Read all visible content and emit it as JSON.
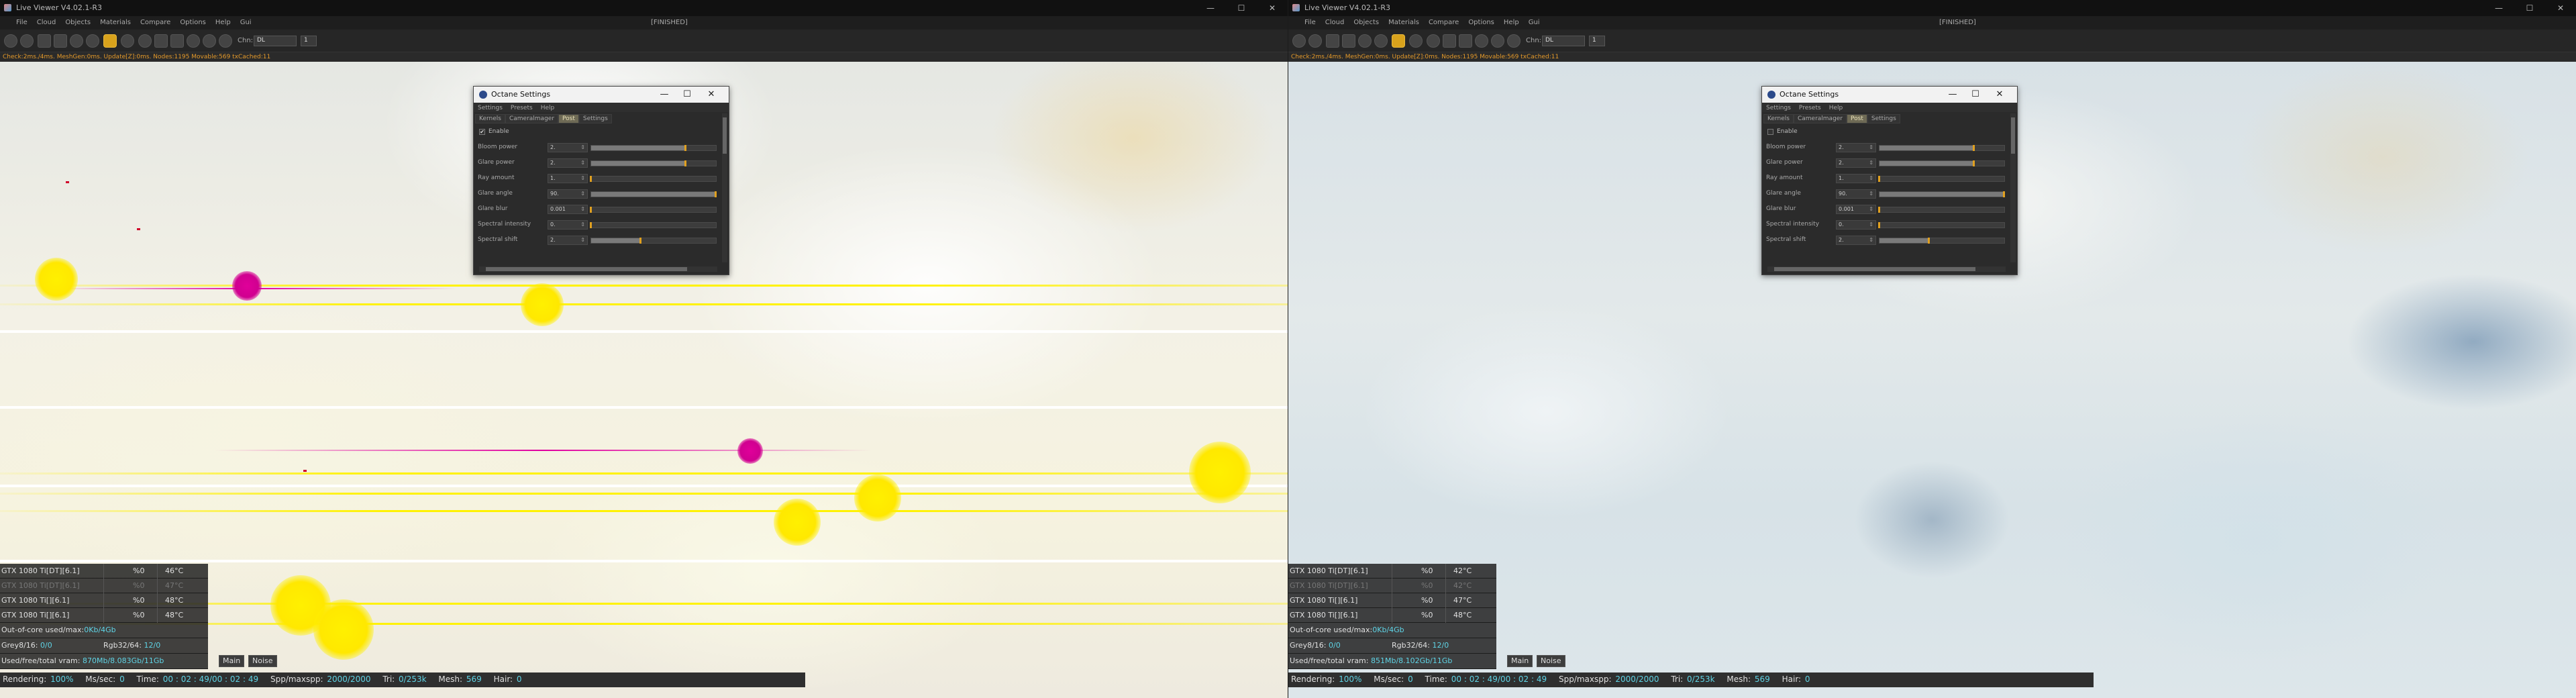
{
  "windows": [
    {
      "title": "Live Viewer V4.02.1-R3",
      "window_controls": [
        "—",
        "☐",
        "✕"
      ],
      "menu": [
        "File",
        "Cloud",
        "Objects",
        "Materials",
        "Compare",
        "Options",
        "Help",
        "Gui"
      ],
      "status": "[FINISHED]",
      "toolbar": {
        "channel_label": "Chn:",
        "channel_value": "DL",
        "count_value": "1"
      },
      "check_info": "Check:2ms./4ms. MeshGen:0ms. Update[Z]:0ms. Nodes:1195 Movable:569 txCached:11",
      "dialog": {
        "title": "Octane Settings",
        "controls": [
          "—",
          "☐",
          "✕"
        ],
        "menu": [
          "Settings",
          "Presets",
          "Help"
        ],
        "tabs": [
          "Kernels",
          "Cameralmager",
          "Post",
          "Settings"
        ],
        "active_tab": "Post",
        "enable_label": "Enable",
        "enable_checked": true,
        "params": [
          {
            "label": "Bloom power",
            "value": "2.",
            "level": 0.76
          },
          {
            "label": "Glare power",
            "value": "2.",
            "level": 0.76
          },
          {
            "label": "Ray amount",
            "value": "1.",
            "level": 0.0
          },
          {
            "label": "Glare angle",
            "value": "90.",
            "level": 1.0
          },
          {
            "label": "Glare blur",
            "value": "0.001",
            "level": 0.0
          },
          {
            "label": "Spectral intensity",
            "value": "0.",
            "level": 0.0
          },
          {
            "label": "Spectral shift",
            "value": "2.",
            "level": 0.4
          }
        ]
      },
      "gpus": [
        {
          "name": "GTX 1080 Ti[DT][6.1]",
          "pct": "%0",
          "temp": "46°C",
          "dim": false
        },
        {
          "name": "GTX 1080 Ti[DT][6.1]",
          "pct": "%0",
          "temp": "47°C",
          "dim": true
        },
        {
          "name": "GTX 1080 Ti[][6.1]",
          "pct": "%0",
          "temp": "48°C",
          "dim": false
        },
        {
          "name": "GTX 1080 Ti[][6.1]",
          "pct": "%0",
          "temp": "48°C",
          "dim": false
        }
      ],
      "out_of_core": {
        "label": "Out-of-core used/max:",
        "value": "0Kb/4Gb"
      },
      "grey": {
        "label": "Grey8/16:",
        "value": "0/0"
      },
      "rgb": {
        "label": "Rgb32/64:",
        "value": "12/0"
      },
      "vram": {
        "label": "Used/free/total vram:",
        "value": "870Mb/8.083Gb/11Gb"
      },
      "buttons": {
        "main": "Main",
        "noise": "Noise"
      },
      "render": {
        "rendering_label": "Rendering:",
        "rendering_value": "100%",
        "mssec_label": "Ms/sec:",
        "mssec_value": "0",
        "time_label": "Time:",
        "time_value": "00 : 02 : 49/00 : 02 : 49",
        "spp_label": "Spp/maxspp:",
        "spp_value": "2000/2000",
        "tri_label": "Tri:",
        "tri_value": "0/253k",
        "mesh_label": "Mesh:",
        "mesh_value": "569",
        "hair_label": "Hair:",
        "hair_value": "0"
      }
    },
    {
      "title": "Live Viewer V4.02.1-R3",
      "window_controls": [
        "—",
        "☐",
        "✕"
      ],
      "menu": [
        "File",
        "Cloud",
        "Objects",
        "Materials",
        "Compare",
        "Options",
        "Help",
        "Gui"
      ],
      "status": "[FINISHED]",
      "toolbar": {
        "channel_label": "Chn:",
        "channel_value": "DL",
        "count_value": "1"
      },
      "check_info": "Check:2ms./4ms. MeshGen:0ms. Update[Z]:0ms. Nodes:1195 Movable:569 txCached:11",
      "dialog": {
        "title": "Octane Settings",
        "controls": [
          "—",
          "☐",
          "✕"
        ],
        "menu": [
          "Settings",
          "Presets",
          "Help"
        ],
        "tabs": [
          "Kernels",
          "Cameralmager",
          "Post",
          "Settings"
        ],
        "active_tab": "Post",
        "enable_label": "Enable",
        "enable_checked": false,
        "params": [
          {
            "label": "Bloom power",
            "value": "2.",
            "level": 0.76
          },
          {
            "label": "Glare power",
            "value": "2.",
            "level": 0.76
          },
          {
            "label": "Ray amount",
            "value": "1.",
            "level": 0.0
          },
          {
            "label": "Glare angle",
            "value": "90.",
            "level": 1.0
          },
          {
            "label": "Glare blur",
            "value": "0.001",
            "level": 0.0
          },
          {
            "label": "Spectral intensity",
            "value": "0.",
            "level": 0.0
          },
          {
            "label": "Spectral shift",
            "value": "2.",
            "level": 0.4
          }
        ]
      },
      "gpus": [
        {
          "name": "GTX 1080 Ti[DT][6.1]",
          "pct": "%0",
          "temp": "42°C",
          "dim": false
        },
        {
          "name": "GTX 1080 Ti[DT][6.1]",
          "pct": "%0",
          "temp": "42°C",
          "dim": true
        },
        {
          "name": "GTX 1080 Ti[][6.1]",
          "pct": "%0",
          "temp": "47°C",
          "dim": false
        },
        {
          "name": "GTX 1080 Ti[][6.1]",
          "pct": "%0",
          "temp": "48°C",
          "dim": false
        }
      ],
      "out_of_core": {
        "label": "Out-of-core used/max:",
        "value": "0Kb/4Gb"
      },
      "grey": {
        "label": "Grey8/16:",
        "value": "0/0"
      },
      "rgb": {
        "label": "Rgb32/64:",
        "value": "12/0"
      },
      "vram": {
        "label": "Used/free/total vram:",
        "value": "851Mb/8.102Gb/11Gb"
      },
      "buttons": {
        "main": "Main",
        "noise": "Noise"
      },
      "render": {
        "rendering_label": "Rendering:",
        "rendering_value": "100%",
        "mssec_label": "Ms/sec:",
        "mssec_value": "0",
        "time_label": "Time:",
        "time_value": "00 : 02 : 49/00 : 02 : 49",
        "spp_label": "Spp/maxspp:",
        "spp_value": "2000/2000",
        "tri_label": "Tri:",
        "tri_value": "0/253k",
        "mesh_label": "Mesh:",
        "mesh_value": "569",
        "hair_label": "Hair:",
        "hair_value": "0"
      }
    }
  ],
  "colors": {
    "accent_value": "#5fd4e6",
    "lock": "#d8a21c",
    "active_tab": "#6e6a55",
    "slider_knob": "#e0a020",
    "check_info": "#e59a2a",
    "glare_yellow": "#fff200",
    "glare_magenta": "#e000a0"
  }
}
